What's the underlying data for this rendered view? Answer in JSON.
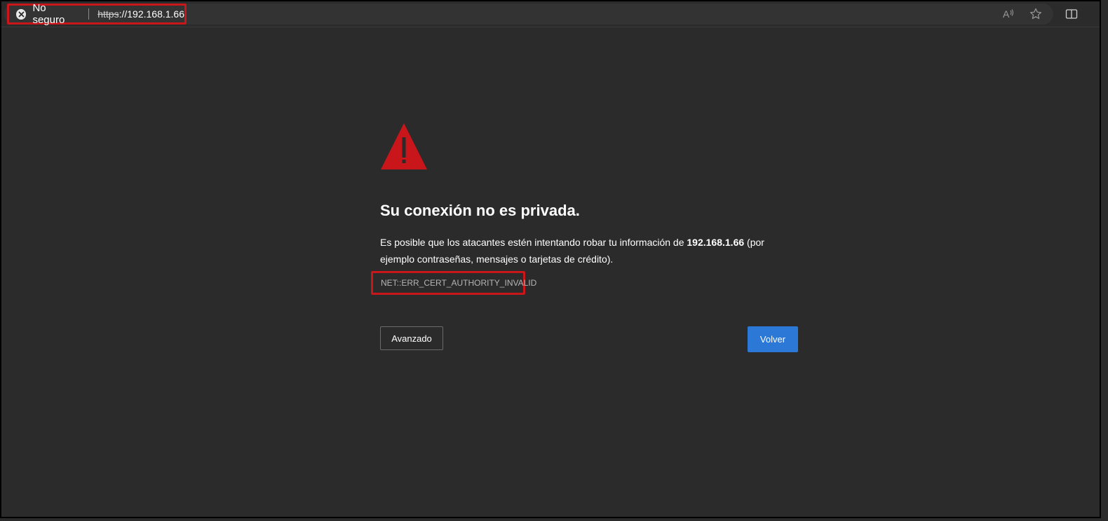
{
  "addressbar": {
    "security_label": "No seguro",
    "url_scheme": "https",
    "url_rest": "://192.168.1.66"
  },
  "toolbar_icons": {
    "read_aloud": "read-aloud-icon",
    "favorite": "star-icon",
    "split_screen": "split-screen-icon"
  },
  "error_page": {
    "headline": "Su conexión no es privada.",
    "desc_before": "Es posible que los atacantes estén intentando robar tu información de ",
    "desc_host": "192.168.1.66",
    "desc_after": " (por ejemplo contraseñas, mensajes o tarjetas de crédito).",
    "error_code": "NET::ERR_CERT_AUTHORITY_INVALID",
    "advanced_label": "Avanzado",
    "back_label": "Volver"
  },
  "colors": {
    "background": "#2b2b2b",
    "warning_red": "#c8161b",
    "primary_blue": "#2b78d6"
  }
}
